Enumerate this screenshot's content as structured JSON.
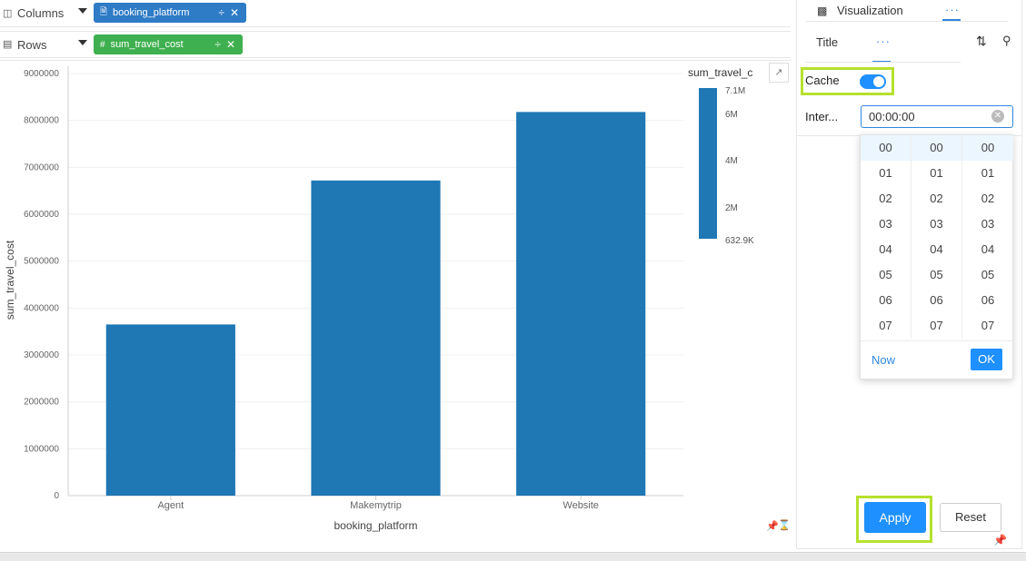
{
  "shelves": {
    "columns_label": "Columns",
    "rows_label": "Rows",
    "columns_pill": "booking_platform",
    "rows_pill": "sum_travel_cost",
    "columns_icon": "columns-icon",
    "rows_icon": "rows-icon"
  },
  "colors": {
    "bar": "#1f77b4",
    "pill_blue": "#2e7bc6",
    "pill_green": "#3fb04f",
    "accent": "#1e90ff",
    "highlight": "#b6e12e"
  },
  "chart_data": {
    "type": "bar",
    "categories": [
      "Agent",
      "Makemytrip",
      "Website"
    ],
    "values": [
      3650000,
      6720000,
      8180000
    ],
    "xlabel": "booking_platform",
    "ylabel": "sum_travel_cost",
    "ylim": [
      0,
      9000000
    ],
    "yticks": [
      "0",
      "1000000",
      "2000000",
      "3000000",
      "4000000",
      "5000000",
      "6000000",
      "7000000",
      "8000000",
      "9000000"
    ],
    "legend": {
      "title": "sum_travel_c",
      "ticks": [
        "7.1M",
        "6M",
        "4M",
        "2M",
        "632.9K"
      ],
      "placement": "right"
    },
    "grid": true
  },
  "panel": {
    "tab_visualization": "Visualization",
    "tab_title": "Title",
    "more_dots": "···",
    "cache_label": "Cache",
    "cache_on": true,
    "interval_label": "Inter...",
    "interval_value": "00:00:00",
    "picker": {
      "hours": [
        "00",
        "01",
        "02",
        "03",
        "04",
        "05",
        "06",
        "07"
      ],
      "minutes": [
        "00",
        "01",
        "02",
        "03",
        "04",
        "05",
        "06",
        "07"
      ],
      "seconds": [
        "00",
        "01",
        "02",
        "03",
        "04",
        "05",
        "06",
        "07"
      ],
      "now_label": "Now",
      "ok_label": "OK"
    },
    "apply_label": "Apply",
    "reset_label": "Reset"
  }
}
